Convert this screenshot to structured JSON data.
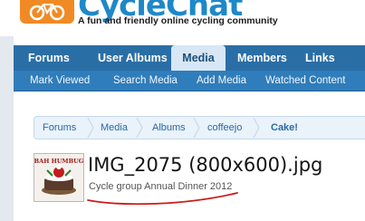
{
  "header": {
    "logo_text": "CycleChat",
    "tagline": "A fun and friendly online cycling community"
  },
  "nav": {
    "tabs": [
      {
        "label": "Forums"
      },
      {
        "label": "User Albums"
      },
      {
        "label": "Media",
        "active": true
      },
      {
        "label": "Members"
      },
      {
        "label": "Links"
      }
    ]
  },
  "subnav": {
    "items": [
      {
        "label": "Mark Viewed"
      },
      {
        "label": "Search Media"
      },
      {
        "label": "Add Media"
      },
      {
        "label": "Watched Content"
      }
    ]
  },
  "breadcrumb": {
    "items": [
      {
        "label": "Forums"
      },
      {
        "label": "Media"
      },
      {
        "label": "Albums"
      },
      {
        "label": "coffeejo"
      },
      {
        "label": "Cake!"
      }
    ]
  },
  "media": {
    "title": "IMG_2075 (800x600).jpg",
    "subtitle": "Cycle group Annual Dinner 2012",
    "thumbnail_text": "BAH HUMBUG"
  },
  "colors": {
    "nav_bg": "#2a6ea6",
    "subnav_bg": "#2f7dbb",
    "accent_orange": "#f08a24",
    "logo_blue": "#1e88c8",
    "annotation_red": "#cc1a1a"
  }
}
